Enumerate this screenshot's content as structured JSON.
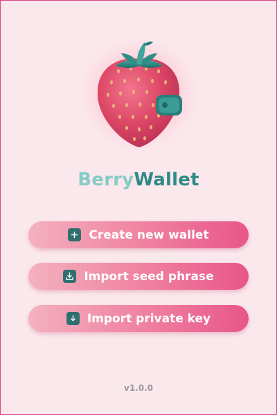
{
  "app": {
    "name_part1": "Berry",
    "name_part2": "Wallet",
    "version": "v1.0.0"
  },
  "actions": [
    {
      "label": "Create new wallet",
      "icon": "plus-icon"
    },
    {
      "label": "Import seed phrase",
      "icon": "download-tray-icon"
    },
    {
      "label": "Import private key",
      "icon": "download-icon"
    }
  ],
  "colors": {
    "background": "#fbe8ec",
    "frame_border": "#d9478a",
    "title_light": "#86cbc6",
    "title_dark": "#2e8a86",
    "button_gradient_start": "#f4b1bf",
    "button_gradient_end": "#e8568a",
    "icon_bg": "#2f6f6e",
    "strawberry": "#e24d6c",
    "leaves": "#2f8d86"
  }
}
